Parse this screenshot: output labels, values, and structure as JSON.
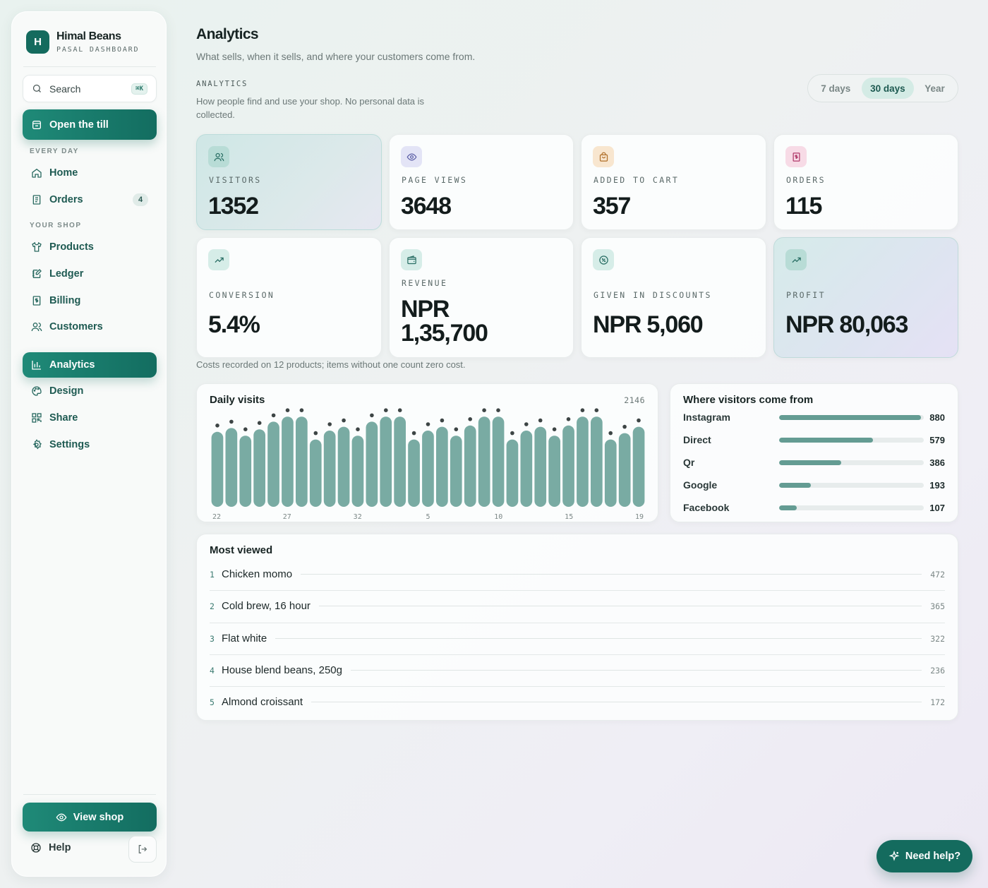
{
  "brand": {
    "logo_letter": "H",
    "name": "Himal Beans",
    "subtitle": "PASAL DASHBOARD"
  },
  "search": {
    "label": "Search",
    "shortcut": "⌘K"
  },
  "till_button": "Open the till",
  "nav": {
    "section_every_day": "EVERY DAY",
    "section_your_shop": "YOUR SHOP",
    "home": "Home",
    "orders": "Orders",
    "orders_badge": "4",
    "products": "Products",
    "ledger": "Ledger",
    "billing": "Billing",
    "customers": "Customers",
    "analytics": "Analytics",
    "design": "Design",
    "share": "Share",
    "settings": "Settings"
  },
  "view_shop_button": "View shop",
  "help_label": "Help",
  "header": {
    "title": "Analytics",
    "subtitle": "What sells, when it sells, and where your customers come from.",
    "section_tag": "ANALYTICS",
    "section_desc": "How people find and use your shop. No personal data is collected."
  },
  "range": {
    "options": [
      "7 days",
      "30 days",
      "Year"
    ],
    "selected": "30 days"
  },
  "stats": {
    "visitors": {
      "label": "VISITORS",
      "value": "1352"
    },
    "page_views": {
      "label": "PAGE VIEWS",
      "value": "3648"
    },
    "added_to_cart": {
      "label": "ADDED TO CART",
      "value": "357"
    },
    "orders": {
      "label": "ORDERS",
      "value": "115"
    },
    "conversion": {
      "label": "CONVERSION",
      "value": "5.4%"
    },
    "revenue": {
      "label": "REVENUE",
      "value_line1": "NPR",
      "value_line2": "1,35,700"
    },
    "discounts": {
      "label": "GIVEN IN DISCOUNTS",
      "value": "NPR 5,060"
    },
    "profit": {
      "label": "PROFIT",
      "value": "NPR 80,063"
    }
  },
  "cost_note": "Costs recorded on 12 products; items without one count zero cost.",
  "daily_visits": {
    "title": "Daily visits",
    "total": "2146",
    "tick_labels": [
      "22",
      "27",
      "32",
      "5",
      "10",
      "15",
      "19"
    ],
    "bar_color": "#79aba3",
    "dot_color": "#3d4545"
  },
  "chart_data": {
    "type": "bar",
    "title": "Daily visits",
    "x_tick_labels": [
      "22",
      "27",
      "32",
      "5",
      "10",
      "15",
      "19"
    ],
    "values": [
      59,
      62,
      56,
      61,
      67,
      71,
      71,
      53,
      60,
      63,
      56,
      67,
      71,
      71,
      53,
      60,
      63,
      56,
      64,
      71,
      71,
      53,
      60,
      63,
      56,
      64,
      71,
      71,
      53,
      58,
      63
    ],
    "ylim": [
      0,
      80
    ],
    "grid": false
  },
  "sources": {
    "title": "Where visitors come from",
    "items": [
      {
        "name": "Instagram",
        "value": "880",
        "fraction": 0.98
      },
      {
        "name": "Direct",
        "value": "579",
        "fraction": 0.65
      },
      {
        "name": "Qr",
        "value": "386",
        "fraction": 0.43
      },
      {
        "name": "Google",
        "value": "193",
        "fraction": 0.22
      },
      {
        "name": "Facebook",
        "value": "107",
        "fraction": 0.12
      }
    ]
  },
  "most_viewed": {
    "title": "Most viewed",
    "items": [
      {
        "rank": "1",
        "name": "Chicken momo",
        "value": "472"
      },
      {
        "rank": "2",
        "name": "Cold brew, 16 hour",
        "value": "365"
      },
      {
        "rank": "3",
        "name": "Flat white",
        "value": "322"
      },
      {
        "rank": "4",
        "name": "House blend beans, 250g",
        "value": "236"
      },
      {
        "rank": "5",
        "name": "Almond croissant",
        "value": "172"
      }
    ]
  },
  "need_help_button": "Need help?",
  "colors": {
    "accent": "#146b5e",
    "accent_light": "#1f8a78",
    "bar_fill": "#649c93"
  }
}
